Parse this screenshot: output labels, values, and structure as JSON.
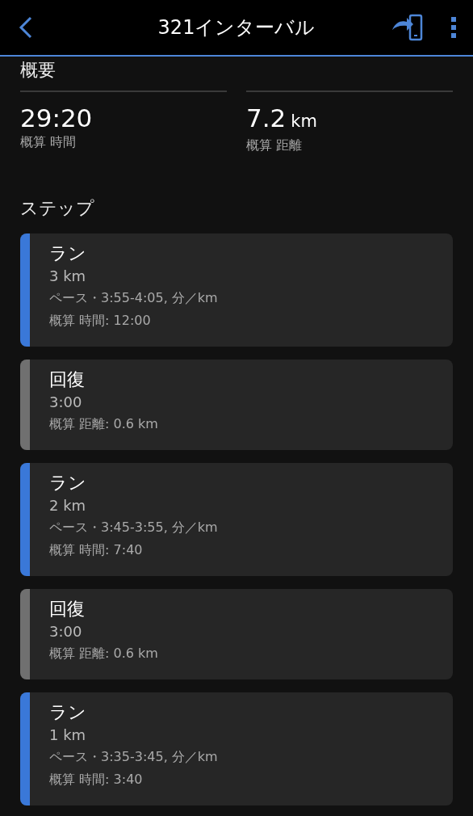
{
  "header": {
    "title": "321インターバル"
  },
  "overview": {
    "title": "概要",
    "stats": [
      {
        "value": "29:20",
        "label": "概算 時間"
      },
      {
        "value": "7.2",
        "unit": "km",
        "label": "概算 距離"
      }
    ]
  },
  "steps": {
    "title": "ステップ",
    "items": [
      {
        "color": "#3a78d8",
        "name": "ラン",
        "amount": "3 km",
        "details": [
          "ペース・3:55-4:05, 分／km",
          "概算 時間: 12:00"
        ]
      },
      {
        "color": "#707070",
        "name": "回復",
        "amount": "3:00",
        "details": [
          "概算 距離: 0.6 km"
        ]
      },
      {
        "color": "#3a78d8",
        "name": "ラン",
        "amount": "2 km",
        "details": [
          "ペース・3:45-3:55, 分／km",
          "概算 時間: 7:40"
        ]
      },
      {
        "color": "#707070",
        "name": "回復",
        "amount": "3:00",
        "details": [
          "概算 距離: 0.6 km"
        ]
      },
      {
        "color": "#3a78d8",
        "name": "ラン",
        "amount": "1 km",
        "details": [
          "ペース・3:35-3:45, 分／km",
          "概算 時間: 3:40"
        ]
      }
    ]
  }
}
